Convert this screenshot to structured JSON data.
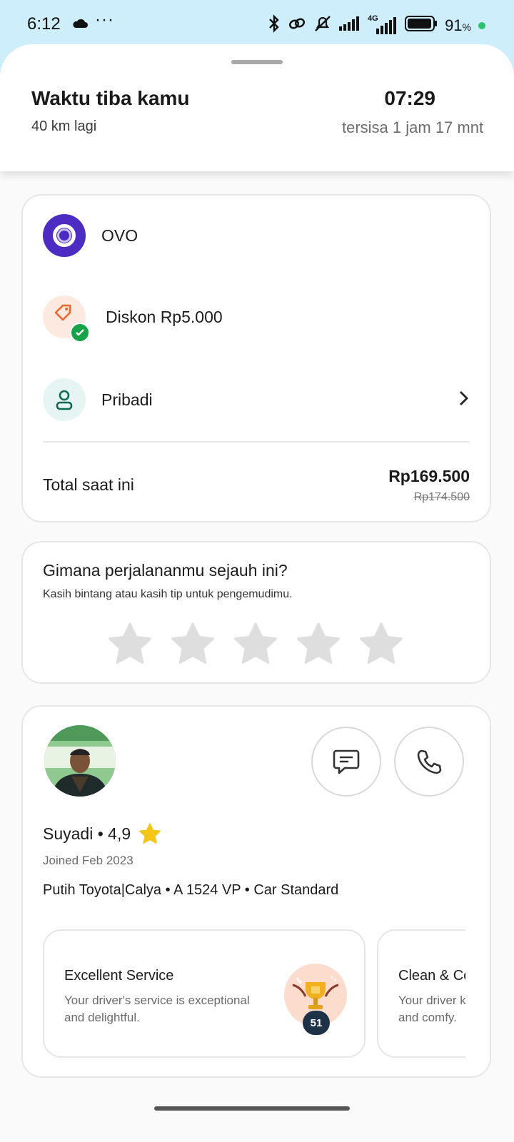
{
  "status_bar": {
    "time": "6:12",
    "more": "···",
    "battery_percent": "91",
    "battery_unit": "%",
    "network": "4G",
    "icons": [
      "cloud-icon",
      "bluetooth-icon",
      "link-icon",
      "mute-icon",
      "signal-icon",
      "signal-4g-icon",
      "battery-icon"
    ]
  },
  "eta": {
    "title": "Waktu tiba kamu",
    "distance": "40 km lagi",
    "arrival_time": "07:29",
    "remaining": "tersisa 1 jam 17 mnt"
  },
  "payment": {
    "method": "OVO",
    "discount": "Diskon Rp5.000",
    "profile": "Pribadi",
    "total_label": "Total saat ini",
    "total_price": "Rp169.500",
    "original_price": "Rp174.500"
  },
  "rating": {
    "title": "Gimana perjalananmu sejauh ini?",
    "subtitle": "Kasih bintang atau kasih tip untuk pengemudimu.",
    "star_count": 5,
    "selected": 0
  },
  "driver": {
    "name_rating": "Suyadi • 4,9",
    "joined": "Joined Feb 2023",
    "vehicle": "Putih Toyota|Calya • A 1524 VP • Car Standard",
    "badges": [
      {
        "title": "Excellent Service",
        "desc": "Your driver's service is exceptional and delightful.",
        "count": "51"
      },
      {
        "title": "Clean & Comfy",
        "desc": "Your driver keeps the car spotless and comfy."
      }
    ]
  },
  "colors": {
    "ovo": "#4d2cc4",
    "discount_bg": "#fde9df",
    "check_green": "#17a34a",
    "star_inactive": "#dedede",
    "star_rating": "#f5c518",
    "badge_dark": "#1d3247"
  }
}
